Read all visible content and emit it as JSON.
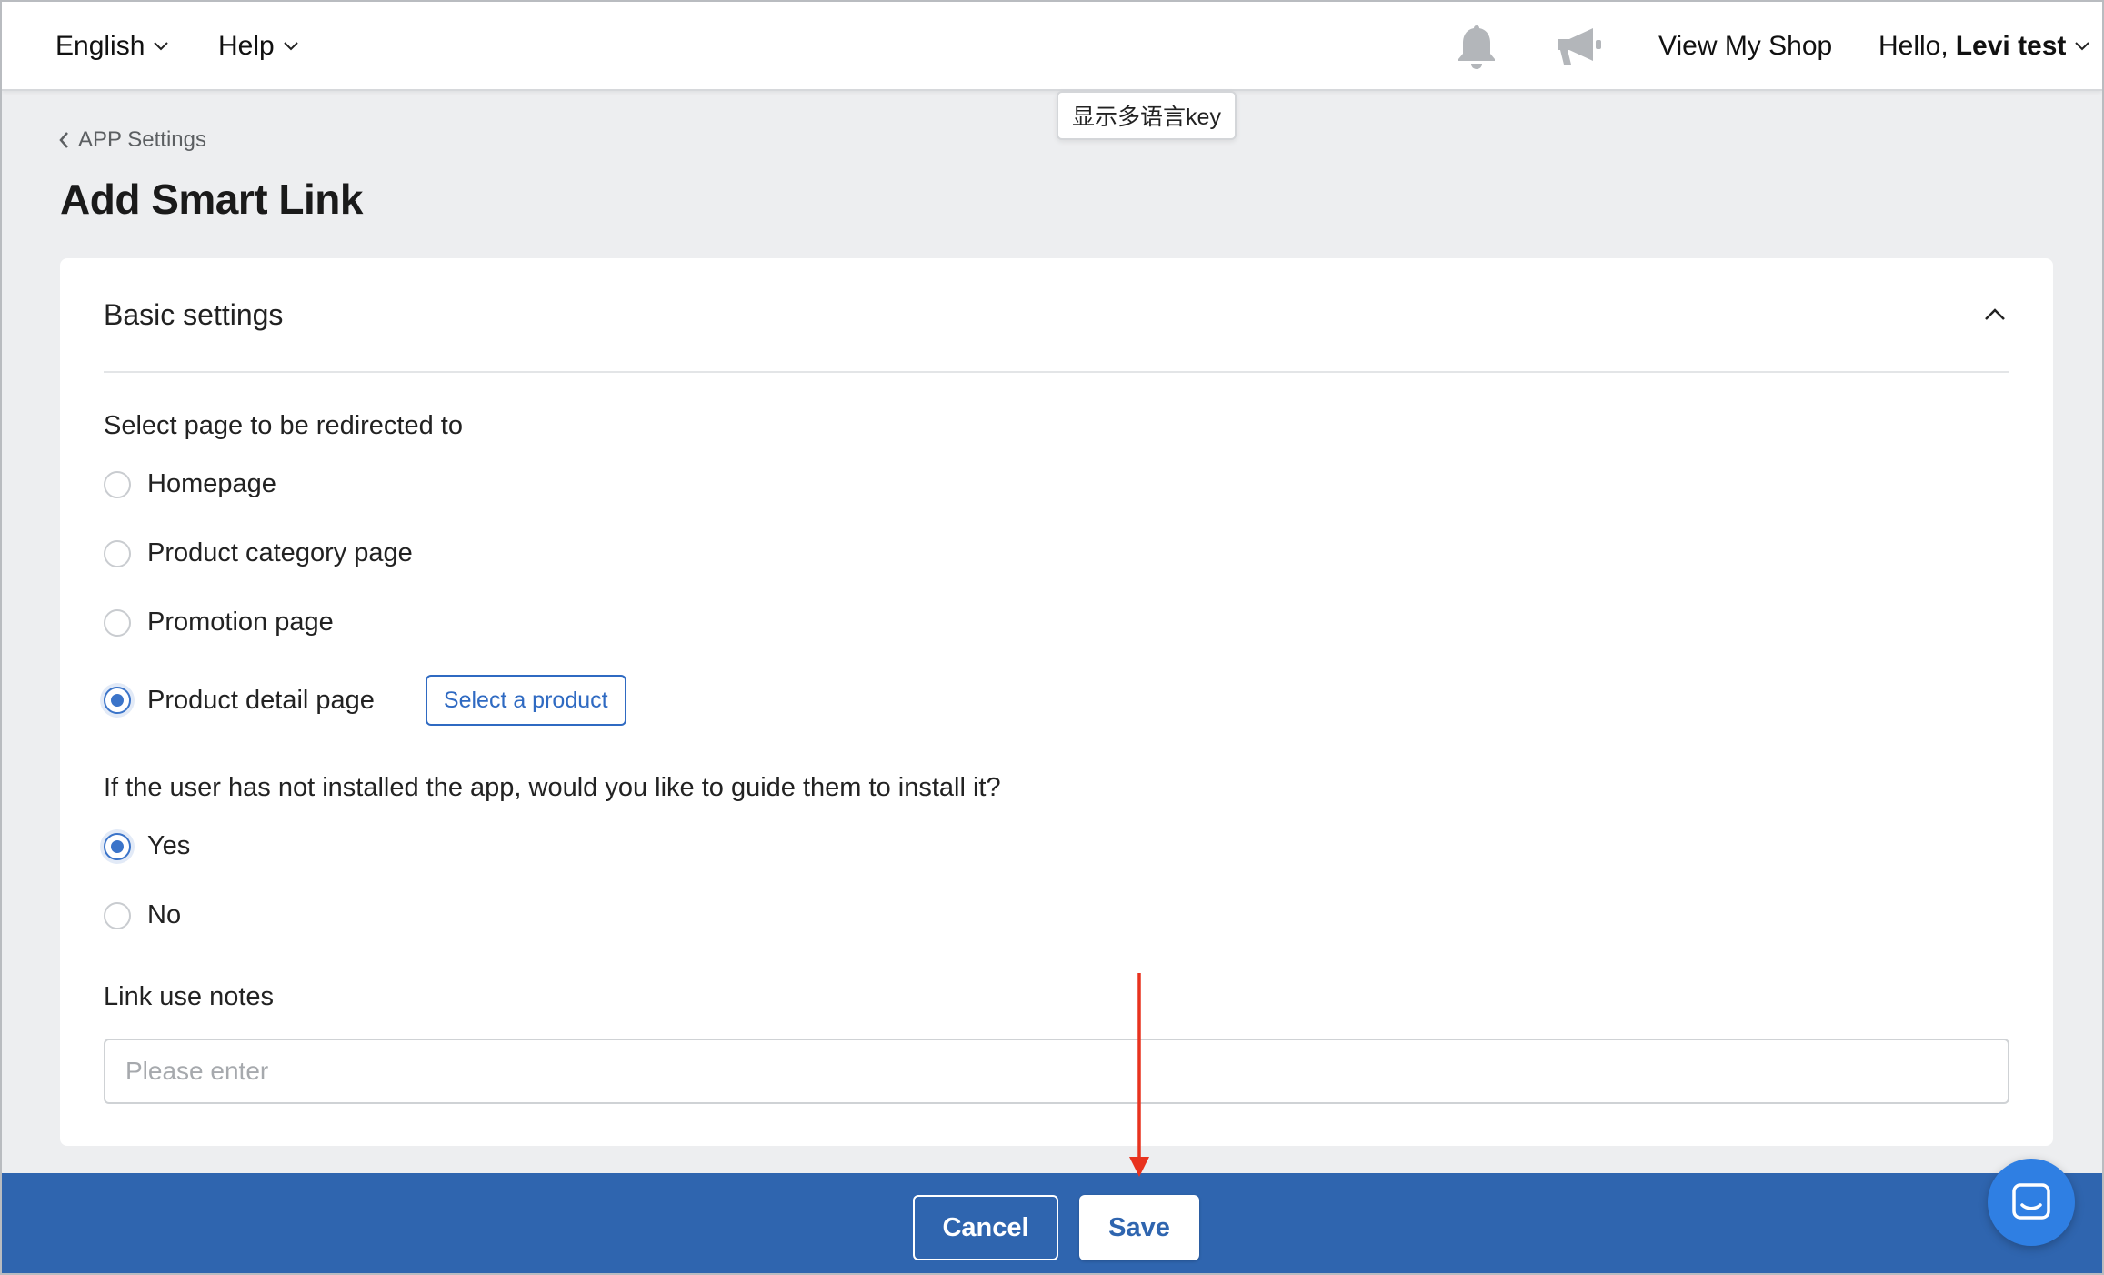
{
  "topbar": {
    "language": "English",
    "help": "Help",
    "view_shop": "View My Shop",
    "greeting": "Hello,",
    "user_name": "Levi test",
    "bell_icon": "bell-icon",
    "megaphone_icon": "megaphone-icon"
  },
  "tooltip": {
    "lang_key": "显示多语言key"
  },
  "header": {
    "breadcrumb": "APP Settings",
    "title": "Add Smart Link"
  },
  "card": {
    "title": "Basic settings",
    "redirect": {
      "label": "Select page to be redirected to",
      "options": [
        {
          "label": "Homepage",
          "selected": false
        },
        {
          "label": "Product category page",
          "selected": false
        },
        {
          "label": "Promotion page",
          "selected": false
        },
        {
          "label": "Product detail page",
          "selected": true
        }
      ],
      "select_product_label": "Select a product"
    },
    "install_guide": {
      "label": "If the user has not installed the app, would you like to guide them to install it?",
      "options": [
        {
          "label": "Yes",
          "selected": true
        },
        {
          "label": "No",
          "selected": false
        }
      ]
    },
    "notes": {
      "label": "Link use notes",
      "placeholder": "Please enter",
      "value": ""
    }
  },
  "actions": {
    "cancel": "Cancel",
    "save": "Save"
  },
  "colors": {
    "primary": "#2f65af",
    "radio_selected": "#3b74c9",
    "annotation_arrow": "#e8321e",
    "chat": "#2f7fe3"
  }
}
